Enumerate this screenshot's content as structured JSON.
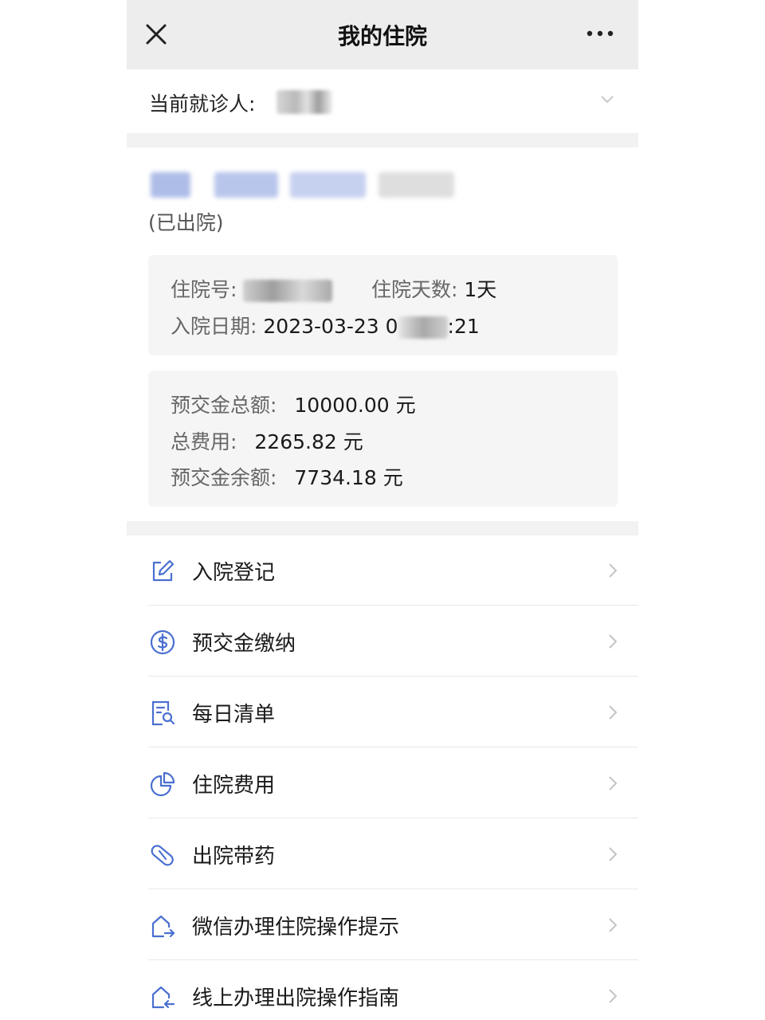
{
  "header": {
    "title": "我的住院"
  },
  "patient": {
    "label": "当前就诊人:"
  },
  "admission": {
    "status": "(已出院)",
    "info": {
      "number_label": "住院号:",
      "days_label": "住院天数:",
      "days_value": "1天",
      "date_label": "入院日期:",
      "date_prefix": "2023-03-23 0",
      "date_suffix": ":21"
    },
    "fees": {
      "deposit_label": "预交金总额:",
      "deposit_value": "10000.00 元",
      "total_label": "总费用:",
      "total_value": "2265.82 元",
      "balance_label": "预交金余额:",
      "balance_value": "7734.18 元"
    }
  },
  "menu": [
    {
      "label": "入院登记",
      "icon": "edit-icon"
    },
    {
      "label": "预交金缴纳",
      "icon": "dollar-circle-icon"
    },
    {
      "label": "每日清单",
      "icon": "document-search-icon"
    },
    {
      "label": "住院费用",
      "icon": "pie-chart-icon"
    },
    {
      "label": "出院带药",
      "icon": "pill-icon"
    },
    {
      "label": "微信办理住院操作提示",
      "icon": "house-exit-icon"
    },
    {
      "label": "线上办理出院操作指南",
      "icon": "house-return-icon"
    }
  ],
  "colors": {
    "accent": "#4a6fd0",
    "topbar": "#ededed",
    "separator": "#f2f2f2",
    "card": "#f5f5f5"
  }
}
